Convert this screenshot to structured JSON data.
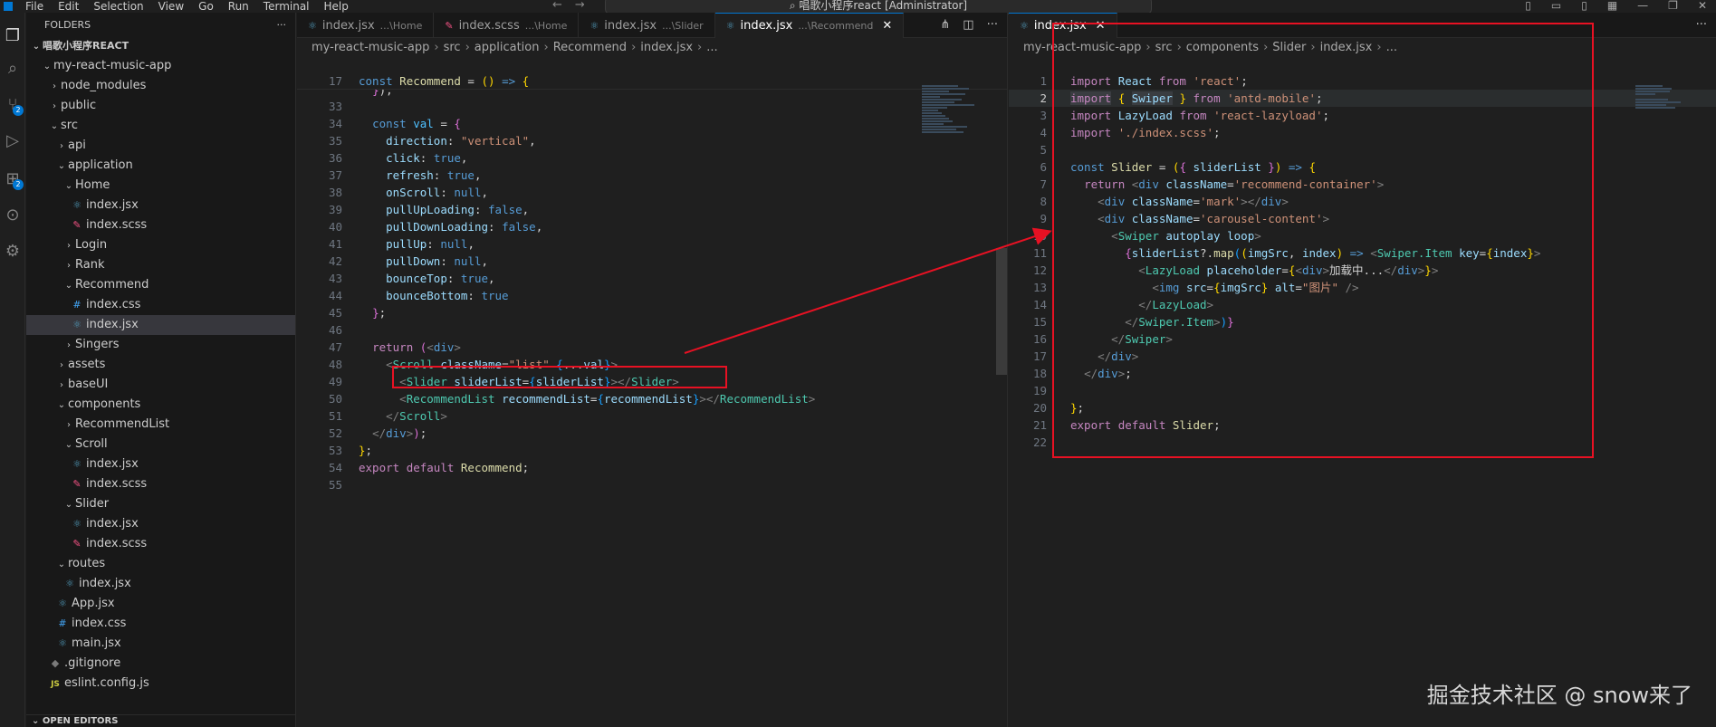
{
  "menu": [
    "File",
    "Edit",
    "Selection",
    "View",
    "Go",
    "Run",
    "Terminal",
    "Help"
  ],
  "window_title": "唱歌小程序react [Administrator]",
  "activity_badges": {
    "source_control": "2",
    "extensions": "2"
  },
  "sidebar": {
    "header": "FOLDERS",
    "tree": [
      {
        "label": "唱歌小程序REACT",
        "indent": 0,
        "kind": "root"
      },
      {
        "label": "my-react-music-app",
        "indent": 1,
        "kind": "open"
      },
      {
        "label": "node_modules",
        "indent": 2,
        "kind": "closed"
      },
      {
        "label": "public",
        "indent": 2,
        "kind": "closed"
      },
      {
        "label": "src",
        "indent": 2,
        "kind": "open"
      },
      {
        "label": "api",
        "indent": 3,
        "kind": "closed"
      },
      {
        "label": "application",
        "indent": 3,
        "kind": "open"
      },
      {
        "label": "Home",
        "indent": 4,
        "kind": "open"
      },
      {
        "label": "index.jsx",
        "indent": 5,
        "kind": "react"
      },
      {
        "label": "index.scss",
        "indent": 5,
        "kind": "scss"
      },
      {
        "label": "Login",
        "indent": 4,
        "kind": "closed"
      },
      {
        "label": "Rank",
        "indent": 4,
        "kind": "closed"
      },
      {
        "label": "Recommend",
        "indent": 4,
        "kind": "open"
      },
      {
        "label": "index.css",
        "indent": 5,
        "kind": "css"
      },
      {
        "label": "index.jsx",
        "indent": 5,
        "kind": "react",
        "selected": true
      },
      {
        "label": "Singers",
        "indent": 4,
        "kind": "closed"
      },
      {
        "label": "assets",
        "indent": 3,
        "kind": "closed"
      },
      {
        "label": "baseUI",
        "indent": 3,
        "kind": "closed"
      },
      {
        "label": "components",
        "indent": 3,
        "kind": "open"
      },
      {
        "label": "RecommendList",
        "indent": 4,
        "kind": "closed"
      },
      {
        "label": "Scroll",
        "indent": 4,
        "kind": "open"
      },
      {
        "label": "index.jsx",
        "indent": 5,
        "kind": "react"
      },
      {
        "label": "index.scss",
        "indent": 5,
        "kind": "scss"
      },
      {
        "label": "Slider",
        "indent": 4,
        "kind": "open"
      },
      {
        "label": "index.jsx",
        "indent": 5,
        "kind": "react"
      },
      {
        "label": "index.scss",
        "indent": 5,
        "kind": "scss"
      },
      {
        "label": "routes",
        "indent": 3,
        "kind": "open"
      },
      {
        "label": "index.jsx",
        "indent": 4,
        "kind": "react"
      },
      {
        "label": "App.jsx",
        "indent": 3,
        "kind": "react"
      },
      {
        "label": "index.css",
        "indent": 3,
        "kind": "css"
      },
      {
        "label": "main.jsx",
        "indent": 3,
        "kind": "react"
      },
      {
        "label": ".gitignore",
        "indent": 2,
        "kind": "git"
      },
      {
        "label": "eslint.config.js",
        "indent": 2,
        "kind": "js"
      }
    ],
    "open_editors": "OPEN EDITORS"
  },
  "group1": {
    "tabs": [
      {
        "name": "index.jsx",
        "desc": "...\\Home",
        "kind": "react"
      },
      {
        "name": "index.scss",
        "desc": "...\\Home",
        "kind": "scss"
      },
      {
        "name": "index.jsx",
        "desc": "...\\Slider",
        "kind": "react"
      },
      {
        "name": "index.jsx",
        "desc": "...\\Recommend",
        "kind": "react",
        "active": true
      }
    ],
    "breadcrumb": [
      "my-react-music-app",
      "src",
      "application",
      "Recommend",
      "index.jsx",
      "..."
    ]
  },
  "group2": {
    "tabs": [
      {
        "name": "index.jsx",
        "kind": "react",
        "active": true
      }
    ],
    "breadcrumb": [
      "my-react-music-app",
      "src",
      "components",
      "Slider",
      "index.jsx",
      "..."
    ]
  },
  "watermark": "掘金技术社区 @ snow来了"
}
